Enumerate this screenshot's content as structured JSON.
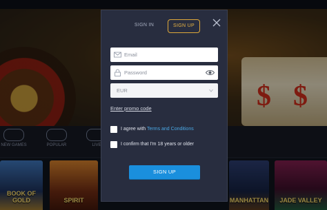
{
  "modal": {
    "tabs": [
      {
        "label": "SIGN IN"
      },
      {
        "label": "SIGN UP"
      }
    ],
    "email": {
      "placeholder": "Email",
      "value": ""
    },
    "password": {
      "placeholder": "Password",
      "value": ""
    },
    "currency": {
      "selected": "EUR"
    },
    "promo_link": "Enter promo code",
    "terms": {
      "prefix": "I agree with ",
      "link": "Terms and Conditions"
    },
    "age_confirm": "I confirm that I'm 18 years or older",
    "submit_label": "SIGN UP"
  },
  "background": {
    "nav": [
      {
        "label": "NEW GAMES"
      },
      {
        "label": "POPULAR"
      },
      {
        "label": "LIVE"
      }
    ],
    "games": [
      {
        "label": "BOOK OF GOLD"
      },
      {
        "label": "SPIRIT"
      },
      {
        "label": "MANHATTAN"
      },
      {
        "label": "JADE VALLEY"
      }
    ]
  },
  "colors": {
    "accent": "#e0a93a",
    "primary_button": "#1a8fdd",
    "link": "#4aa8e6",
    "modal_bg": "#282d3f"
  }
}
